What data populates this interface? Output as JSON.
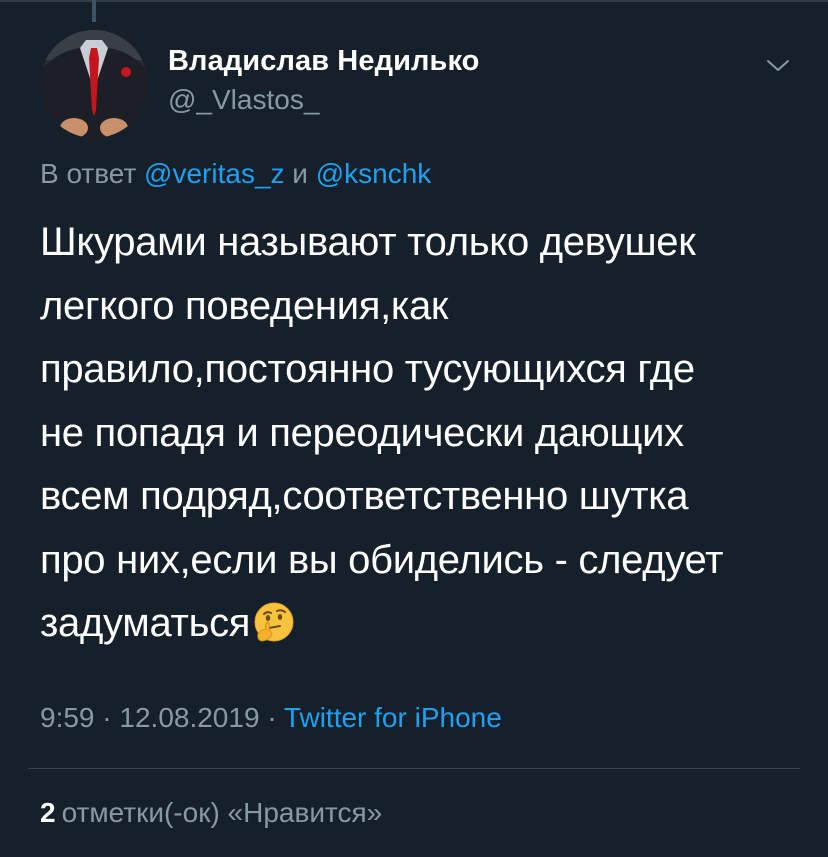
{
  "tweet": {
    "author": {
      "name": "Владислав Недилько",
      "handle": "@_Vlastos_"
    },
    "reply": {
      "prefix": "В ответ",
      "mention1": "@veritas_z",
      "joiner": "и",
      "mention2": "@ksnchk"
    },
    "text_lines": [
      "Шкурами называют только девушек",
      "легкого поведения,как",
      "правило,постоянно тусующихся где",
      "не попадя и переодически дающих",
      "всем подряд,соответственно шутка",
      "про них,если вы обиделись - следует",
      "задуматься"
    ],
    "emoji": "thinking-face-emoji",
    "time": "9:59",
    "separator": "·",
    "date": "12.08.2019",
    "source": "Twitter for iPhone",
    "likes": {
      "count": "2",
      "label": "отметки(-ок) «Нравится»"
    }
  },
  "colors": {
    "background": "#15202b",
    "text": "#ffffff",
    "secondary": "#8899a6",
    "link": "#1da1f2",
    "divider": "#38444d"
  }
}
